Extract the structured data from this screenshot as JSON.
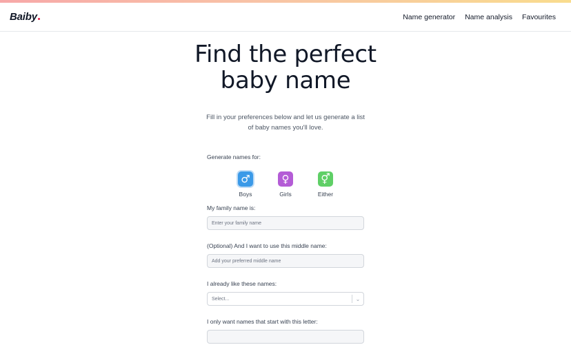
{
  "header": {
    "logo": "Baiby",
    "nav": [
      "Name generator",
      "Name analysis",
      "Favourites"
    ]
  },
  "hero": {
    "title": "Find the perfect baby name",
    "subtitle": "Fill in your preferences below and let us generate a list of baby names you'll love."
  },
  "form": {
    "generate_label": "Generate names for:",
    "genders": [
      {
        "label": "Boys",
        "icon": "male-icon",
        "symbol": "♂",
        "color": "#3b9ae8",
        "selected": true
      },
      {
        "label": "Girls",
        "icon": "female-icon",
        "symbol": "♀",
        "color": "#b45cd6",
        "selected": false
      },
      {
        "label": "Either",
        "icon": "either-gender-icon",
        "symbol": "⚥",
        "color": "#5fcf66",
        "selected": false
      }
    ],
    "family_name_label": "My family name is:",
    "family_name_placeholder": "Enter your family name",
    "middle_name_label": "(Optional) And I want to use this middle name:",
    "middle_name_placeholder": "Add your preferred middle name",
    "liked_names_label": "I already like these names:",
    "liked_names_placeholder": "Select...",
    "letter_label": "I only want names that start with this letter:"
  }
}
